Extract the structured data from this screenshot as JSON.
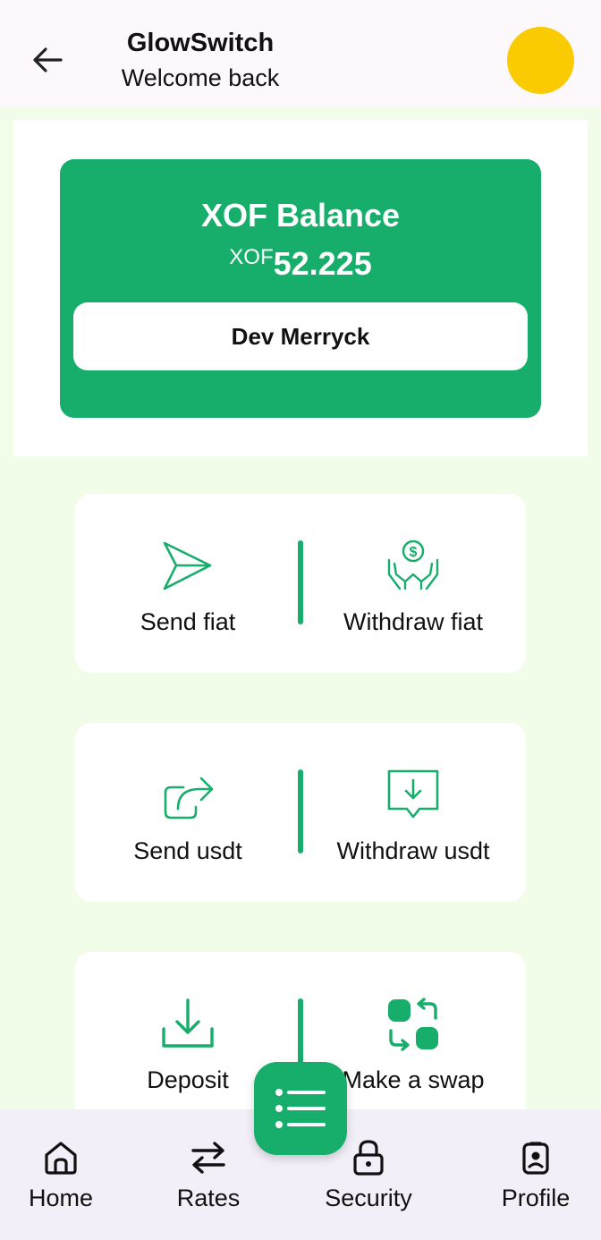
{
  "header": {
    "title": "GlowSwitch",
    "subtitle": "Welcome back",
    "back_icon": "arrow-left-icon",
    "avatar_color": "#facb00"
  },
  "balance": {
    "title": "XOF Balance",
    "currency": "XOF",
    "amount": "52.225",
    "account_name": "Dev Merryck",
    "card_color": "#17ae6b"
  },
  "actions": [
    {
      "left": {
        "label": "Send fiat",
        "icon": "paper-plane-icon"
      },
      "right": {
        "label": "Withdraw fiat",
        "icon": "hands-dollar-icon"
      }
    },
    {
      "left": {
        "label": "Send usdt",
        "icon": "share-icon"
      },
      "right": {
        "label": "Withdraw usdt",
        "icon": "download-box-icon"
      }
    },
    {
      "left": {
        "label": "Deposit",
        "icon": "download-tray-icon"
      },
      "right": {
        "label": "Make a swap",
        "icon": "swap-icon"
      }
    }
  ],
  "nav": {
    "items": [
      {
        "label": "Home",
        "icon": "home-icon"
      },
      {
        "label": "Rates",
        "icon": "arrows-swap-icon"
      },
      {
        "label": "Security",
        "icon": "lock-icon"
      },
      {
        "label": "Profile",
        "icon": "badge-user-icon"
      }
    ],
    "fab_icon": "list-icon"
  }
}
